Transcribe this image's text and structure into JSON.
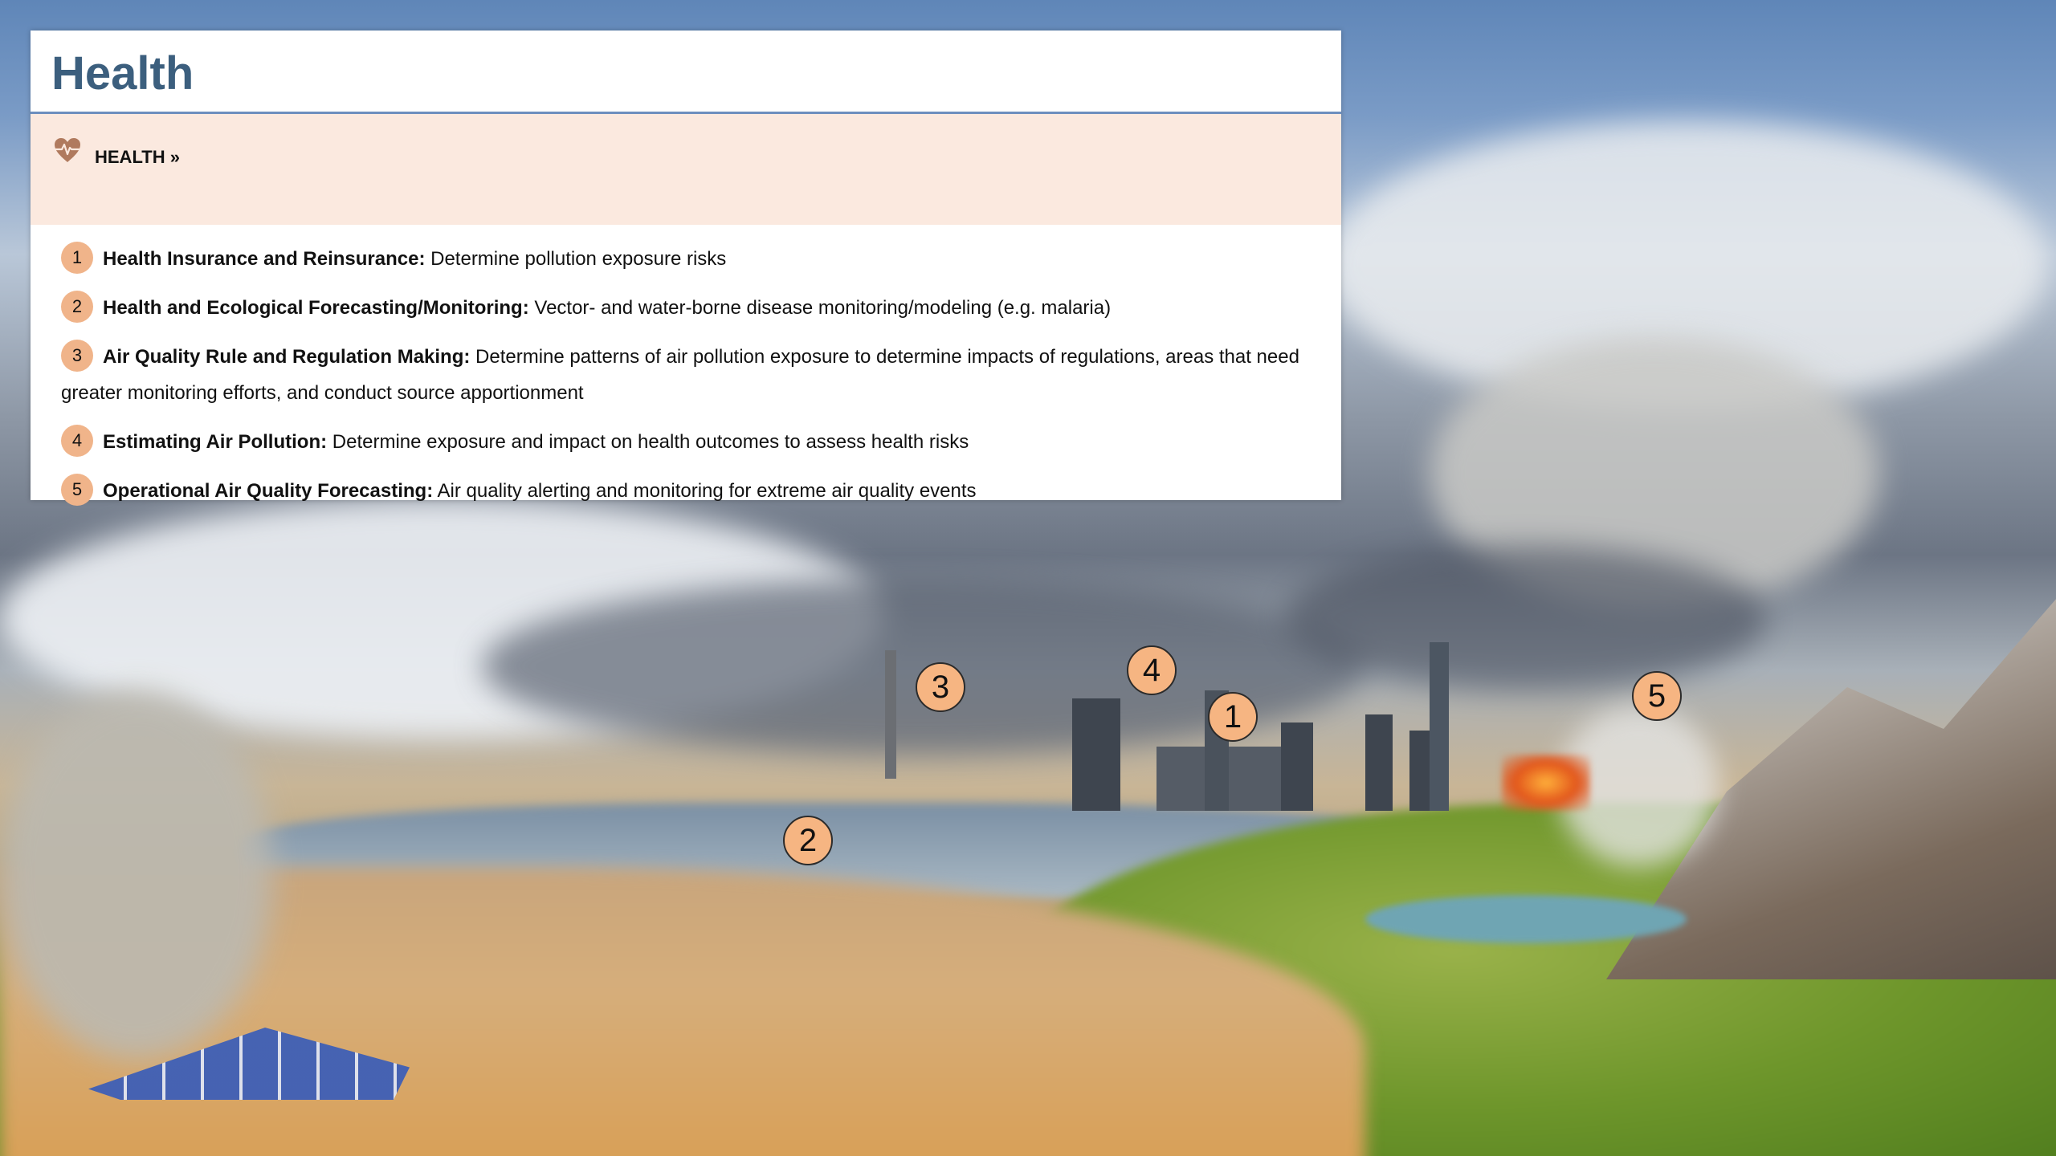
{
  "card": {
    "title": "Health",
    "banner_label": "HEALTH »"
  },
  "items": [
    {
      "num": "1",
      "bold": "Health Insurance and Reinsurance:",
      "text": " Determine pollution exposure risks"
    },
    {
      "num": "2",
      "bold": "Health and Ecological Forecasting/Monitoring:",
      "text": " Vector- and water-borne disease monitoring/modeling (e.g. malaria)"
    },
    {
      "num": "3",
      "bold": "Air Quality Rule and Regulation Making:",
      "text": " Determine patterns of air pollution exposure to determine impacts of regulations, areas that need greater monitoring efforts, and conduct source apportionment"
    },
    {
      "num": "4",
      "bold": "Estimating Air Pollution:",
      "text": " Determine exposure and impact on health outcomes to assess health risks"
    },
    {
      "num": "5",
      "bold": "Operational Air Quality Forecasting:",
      "text": " Air quality alerting and monitoring for extreme air quality events"
    }
  ],
  "markers": [
    "1",
    "2",
    "3",
    "4",
    "5"
  ],
  "colors": {
    "title": "#3c5f7e",
    "banner_bg": "#fbe9df",
    "badge": "#f0b48a",
    "heart": "#b07a5e"
  }
}
